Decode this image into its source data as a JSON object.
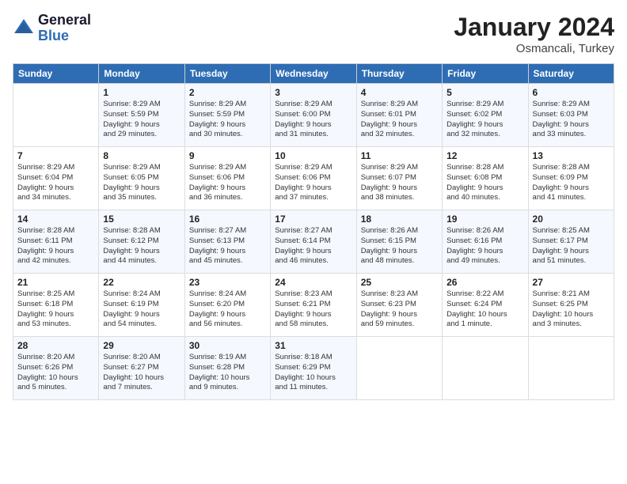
{
  "logo": {
    "general": "General",
    "blue": "Blue"
  },
  "title": "January 2024",
  "location": "Osmancali, Turkey",
  "days_header": [
    "Sunday",
    "Monday",
    "Tuesday",
    "Wednesday",
    "Thursday",
    "Friday",
    "Saturday"
  ],
  "weeks": [
    [
      {
        "day": "",
        "info": ""
      },
      {
        "day": "1",
        "info": "Sunrise: 8:29 AM\nSunset: 5:59 PM\nDaylight: 9 hours\nand 29 minutes."
      },
      {
        "day": "2",
        "info": "Sunrise: 8:29 AM\nSunset: 5:59 PM\nDaylight: 9 hours\nand 30 minutes."
      },
      {
        "day": "3",
        "info": "Sunrise: 8:29 AM\nSunset: 6:00 PM\nDaylight: 9 hours\nand 31 minutes."
      },
      {
        "day": "4",
        "info": "Sunrise: 8:29 AM\nSunset: 6:01 PM\nDaylight: 9 hours\nand 32 minutes."
      },
      {
        "day": "5",
        "info": "Sunrise: 8:29 AM\nSunset: 6:02 PM\nDaylight: 9 hours\nand 32 minutes."
      },
      {
        "day": "6",
        "info": "Sunrise: 8:29 AM\nSunset: 6:03 PM\nDaylight: 9 hours\nand 33 minutes."
      }
    ],
    [
      {
        "day": "7",
        "info": "Sunrise: 8:29 AM\nSunset: 6:04 PM\nDaylight: 9 hours\nand 34 minutes."
      },
      {
        "day": "8",
        "info": "Sunrise: 8:29 AM\nSunset: 6:05 PM\nDaylight: 9 hours\nand 35 minutes."
      },
      {
        "day": "9",
        "info": "Sunrise: 8:29 AM\nSunset: 6:06 PM\nDaylight: 9 hours\nand 36 minutes."
      },
      {
        "day": "10",
        "info": "Sunrise: 8:29 AM\nSunset: 6:06 PM\nDaylight: 9 hours\nand 37 minutes."
      },
      {
        "day": "11",
        "info": "Sunrise: 8:29 AM\nSunset: 6:07 PM\nDaylight: 9 hours\nand 38 minutes."
      },
      {
        "day": "12",
        "info": "Sunrise: 8:28 AM\nSunset: 6:08 PM\nDaylight: 9 hours\nand 40 minutes."
      },
      {
        "day": "13",
        "info": "Sunrise: 8:28 AM\nSunset: 6:09 PM\nDaylight: 9 hours\nand 41 minutes."
      }
    ],
    [
      {
        "day": "14",
        "info": "Sunrise: 8:28 AM\nSunset: 6:11 PM\nDaylight: 9 hours\nand 42 minutes."
      },
      {
        "day": "15",
        "info": "Sunrise: 8:28 AM\nSunset: 6:12 PM\nDaylight: 9 hours\nand 44 minutes."
      },
      {
        "day": "16",
        "info": "Sunrise: 8:27 AM\nSunset: 6:13 PM\nDaylight: 9 hours\nand 45 minutes."
      },
      {
        "day": "17",
        "info": "Sunrise: 8:27 AM\nSunset: 6:14 PM\nDaylight: 9 hours\nand 46 minutes."
      },
      {
        "day": "18",
        "info": "Sunrise: 8:26 AM\nSunset: 6:15 PM\nDaylight: 9 hours\nand 48 minutes."
      },
      {
        "day": "19",
        "info": "Sunrise: 8:26 AM\nSunset: 6:16 PM\nDaylight: 9 hours\nand 49 minutes."
      },
      {
        "day": "20",
        "info": "Sunrise: 8:25 AM\nSunset: 6:17 PM\nDaylight: 9 hours\nand 51 minutes."
      }
    ],
    [
      {
        "day": "21",
        "info": "Sunrise: 8:25 AM\nSunset: 6:18 PM\nDaylight: 9 hours\nand 53 minutes."
      },
      {
        "day": "22",
        "info": "Sunrise: 8:24 AM\nSunset: 6:19 PM\nDaylight: 9 hours\nand 54 minutes."
      },
      {
        "day": "23",
        "info": "Sunrise: 8:24 AM\nSunset: 6:20 PM\nDaylight: 9 hours\nand 56 minutes."
      },
      {
        "day": "24",
        "info": "Sunrise: 8:23 AM\nSunset: 6:21 PM\nDaylight: 9 hours\nand 58 minutes."
      },
      {
        "day": "25",
        "info": "Sunrise: 8:23 AM\nSunset: 6:23 PM\nDaylight: 9 hours\nand 59 minutes."
      },
      {
        "day": "26",
        "info": "Sunrise: 8:22 AM\nSunset: 6:24 PM\nDaylight: 10 hours\nand 1 minute."
      },
      {
        "day": "27",
        "info": "Sunrise: 8:21 AM\nSunset: 6:25 PM\nDaylight: 10 hours\nand 3 minutes."
      }
    ],
    [
      {
        "day": "28",
        "info": "Sunrise: 8:20 AM\nSunset: 6:26 PM\nDaylight: 10 hours\nand 5 minutes."
      },
      {
        "day": "29",
        "info": "Sunrise: 8:20 AM\nSunset: 6:27 PM\nDaylight: 10 hours\nand 7 minutes."
      },
      {
        "day": "30",
        "info": "Sunrise: 8:19 AM\nSunset: 6:28 PM\nDaylight: 10 hours\nand 9 minutes."
      },
      {
        "day": "31",
        "info": "Sunrise: 8:18 AM\nSunset: 6:29 PM\nDaylight: 10 hours\nand 11 minutes."
      },
      {
        "day": "",
        "info": ""
      },
      {
        "day": "",
        "info": ""
      },
      {
        "day": "",
        "info": ""
      }
    ]
  ]
}
